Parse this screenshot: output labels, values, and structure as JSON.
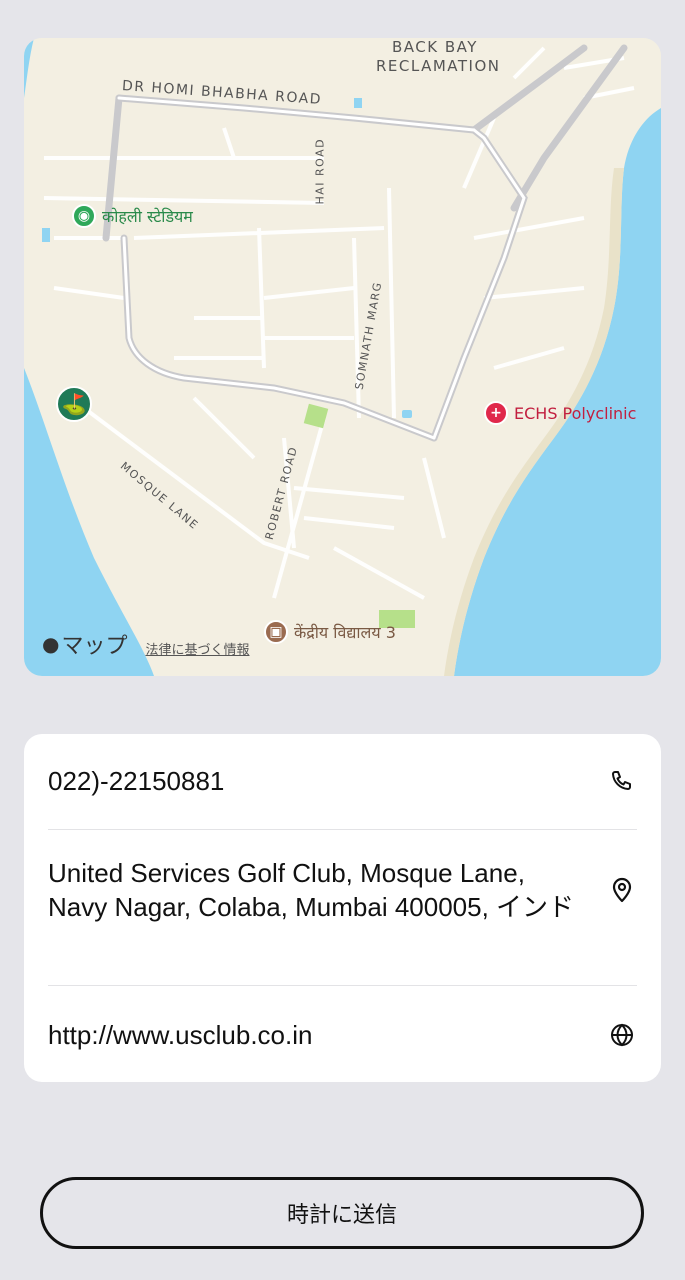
{
  "map": {
    "labels": {
      "back_bay_line1": "BACK BAY",
      "back_bay_line2": "RECLAMATION",
      "dr_homi": "DR HOMI BHABHA ROAD",
      "hai_road": "HAI ROAD",
      "somnath_marg": "SOMNATH MARG",
      "mosque_lane": "MOSQUE LANE",
      "robert_road": "ROBERT ROAD"
    },
    "pois": {
      "stadium": "कोहली स्टेडियम",
      "polyclinic": "ECHS Polyclinic",
      "school": "केंद्रीय विद्यालय 3"
    },
    "brand": "マップ",
    "legal": "法律に基づく情報",
    "colors": {
      "land": "#f3efe2",
      "water": "#8fd4f2",
      "road": "#ffffff",
      "major_road": "#c9c9cc",
      "golf_pin": "#1f7a57",
      "hospital": "#e0284b",
      "stadium": "#2fa85a",
      "school": "#9a6b50"
    }
  },
  "info": {
    "phone": "022)-22150881",
    "address": "United Services Golf Club, Mosque Lane, Navy Nagar, Colaba, Mumbai 400005, インド",
    "website": "http://www.usclub.co.in",
    "icons": {
      "phone": "phone-icon",
      "address": "location-pin-icon",
      "website": "globe-icon"
    }
  },
  "actions": {
    "send_to_watch": "時計に送信"
  }
}
